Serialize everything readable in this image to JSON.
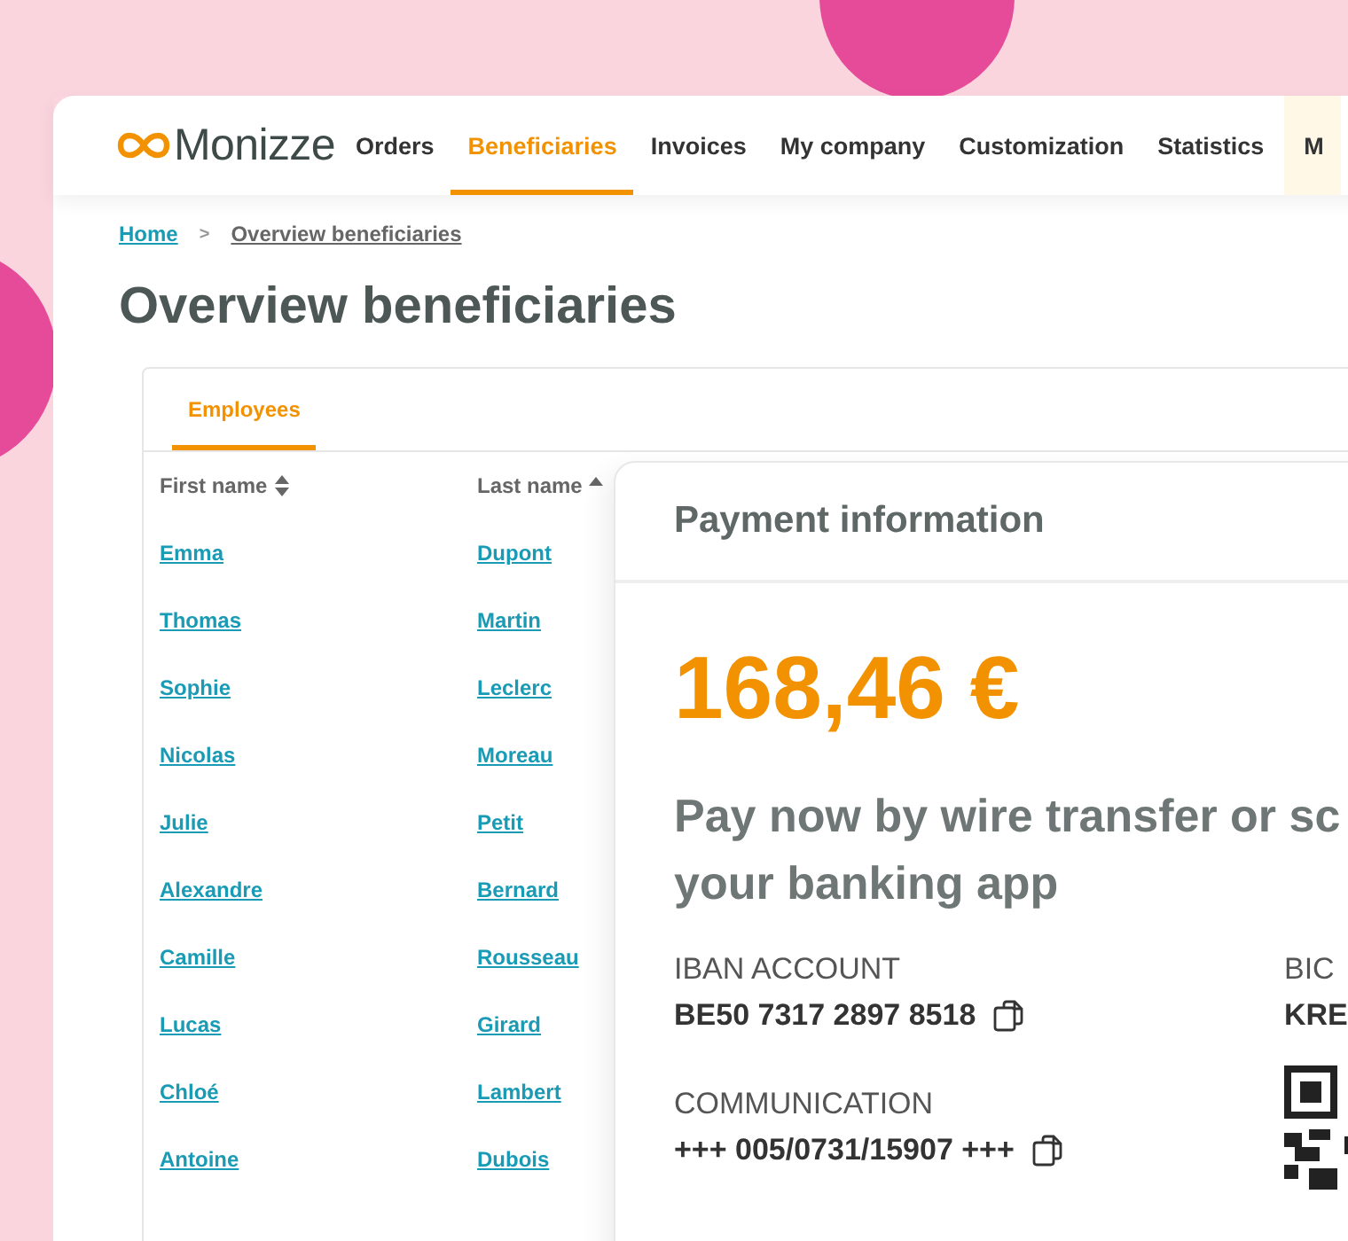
{
  "brand": "Monizze",
  "nav": [
    {
      "label": "Orders",
      "selected": false,
      "kind": "link"
    },
    {
      "label": "Beneficiaries",
      "selected": true,
      "kind": "link"
    },
    {
      "label": "Invoices",
      "selected": false,
      "kind": "link"
    },
    {
      "label": "My company",
      "selected": false,
      "kind": "link"
    },
    {
      "label": "Customization",
      "selected": false,
      "kind": "link"
    },
    {
      "label": "Statistics",
      "selected": false,
      "kind": "link"
    },
    {
      "label": "M",
      "selected": false,
      "kind": "highlight"
    }
  ],
  "breadcrumb": {
    "items": [
      "Home",
      "Overview beneficiaries"
    ],
    "separator": ">"
  },
  "page_title": "Overview beneficiaries",
  "table": {
    "tabs": [
      {
        "label": "Employees",
        "selected": true
      }
    ],
    "columns": [
      {
        "label": "First name",
        "sorted": false
      },
      {
        "label": "Last name",
        "sorted": true
      }
    ],
    "rows": [
      [
        "Emma",
        "Dupont"
      ],
      [
        "Thomas",
        "Martin"
      ],
      [
        "Sophie",
        "Leclerc"
      ],
      [
        "Nicolas",
        "Moreau"
      ],
      [
        "Julie",
        "Petit"
      ],
      [
        "Alexandre",
        "Bernard"
      ],
      [
        "Camille",
        "Rousseau"
      ],
      [
        "Lucas",
        "Girard"
      ],
      [
        "Chloé",
        "Lambert"
      ],
      [
        "Antoine",
        "Dubois"
      ]
    ]
  },
  "payment": {
    "title": "Payment information",
    "amount": "168,46 €",
    "instruction_lines": [
      "Pay now by wire transfer or sc",
      "your banking app"
    ],
    "fields": [
      {
        "label": "IBAN ACCOUNT",
        "value": "BE50 7317 2897 8518",
        "copyable": true
      },
      {
        "label": "COMMUNICATION",
        "value": "+++ 005/0731/15907 +++",
        "copyable": true
      }
    ],
    "bic": {
      "label": "BIC",
      "value": "KRE"
    }
  }
}
